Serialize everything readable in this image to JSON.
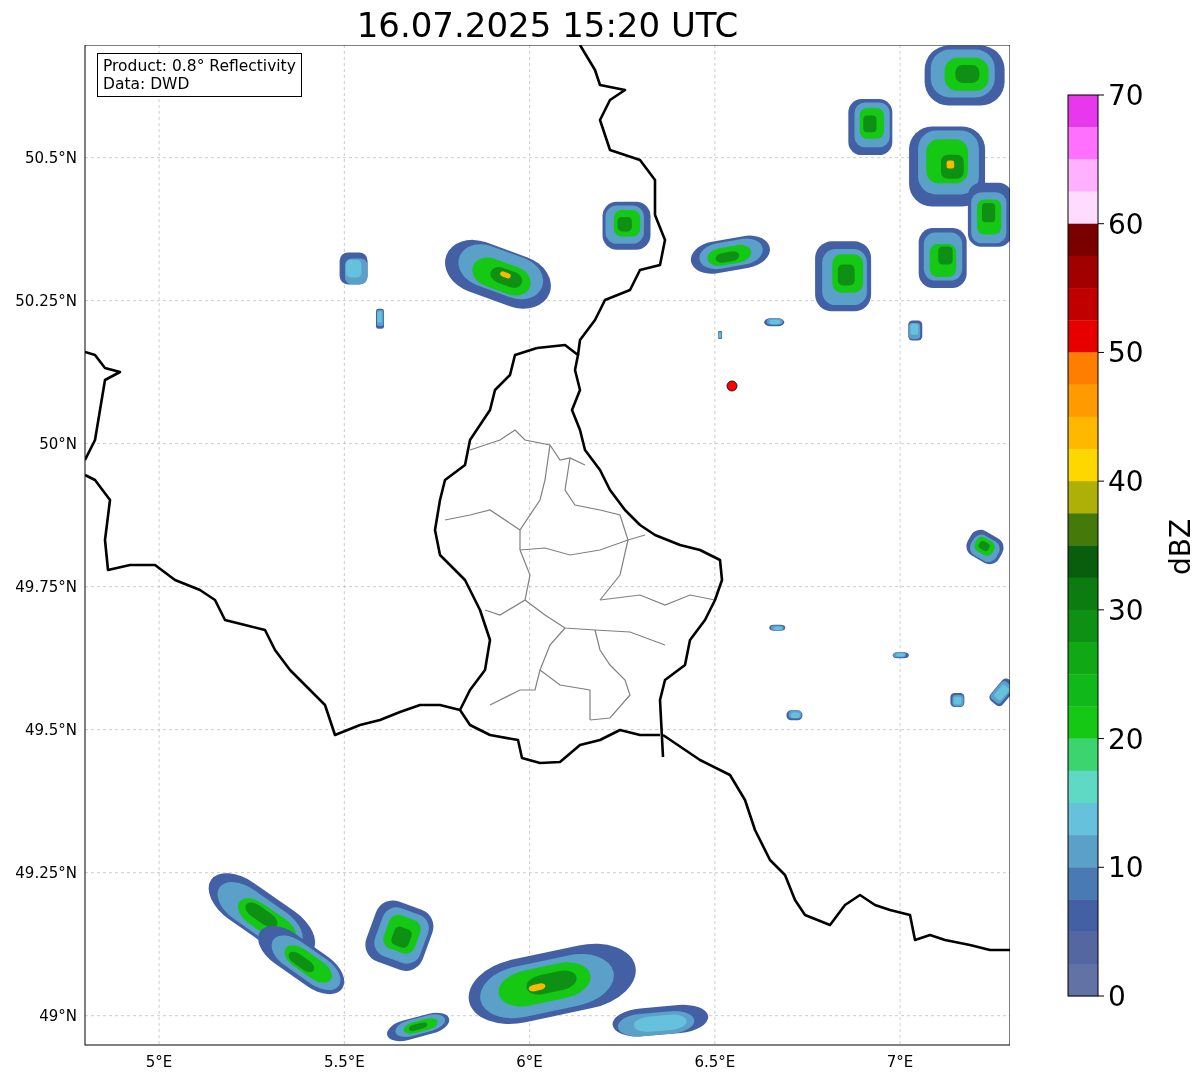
{
  "title": "16.07.2025 15:20 UTC",
  "info_box": [
    "Product: 0.8° Reflectivity",
    "Data: DWD"
  ],
  "x_ticks": [
    "5°E",
    "5.5°E",
    "6°E",
    "6.5°E",
    "7°E"
  ],
  "y_ticks": [
    "50.5°N",
    "50.25°N",
    "50°N",
    "49.75°N",
    "49.5°N",
    "49.25°N",
    "49°N"
  ],
  "colorbar": {
    "label": "dBZ",
    "ticks": [
      "70",
      "60",
      "50",
      "40",
      "30",
      "20",
      "10",
      "0"
    ],
    "bins": [
      {
        "color": "#e838ee"
      },
      {
        "color": "#ff70ff"
      },
      {
        "color": "#ffb0ff"
      },
      {
        "color": "#ffdcff"
      },
      {
        "color": "#7a0000"
      },
      {
        "color": "#a00000"
      },
      {
        "color": "#c00000"
      },
      {
        "color": "#e60000"
      },
      {
        "color": "#ff7d00"
      },
      {
        "color": "#ff9a00"
      },
      {
        "color": "#ffb800"
      },
      {
        "color": "#ffd700"
      },
      {
        "color": "#aeb007"
      },
      {
        "color": "#457a0a"
      },
      {
        "color": "#085e0c"
      },
      {
        "color": "#0c7c10"
      },
      {
        "color": "#0e9014"
      },
      {
        "color": "#10a814"
      },
      {
        "color": "#10b81a"
      },
      {
        "color": "#14c814"
      },
      {
        "color": "#3cd46e"
      },
      {
        "color": "#5fd8c4"
      },
      {
        "color": "#66c2dc"
      },
      {
        "color": "#5aa0c8"
      },
      {
        "color": "#4a7ab4"
      },
      {
        "color": "#4460a4"
      },
      {
        "color": "#5467a0"
      },
      {
        "color": "#6272a4"
      }
    ]
  }
}
